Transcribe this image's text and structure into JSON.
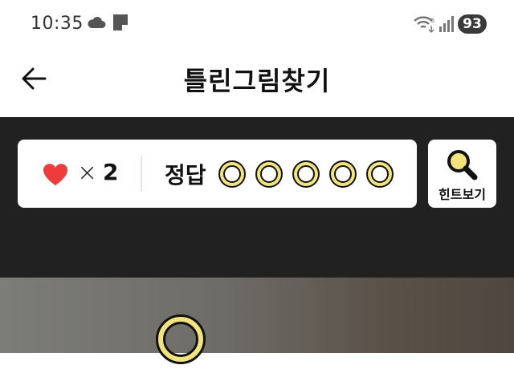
{
  "status_bar": {
    "time": "10:35",
    "icons": [
      "cloud-icon",
      "note-icon",
      "wifi-icon",
      "signal-icon"
    ],
    "battery": "93"
  },
  "app_bar": {
    "back_icon": "arrow-left-icon",
    "title": "틀린그림찾기"
  },
  "game": {
    "lives_icon": "heart-icon",
    "lives_symbol": "×",
    "lives_count": "2",
    "answer_label": "정답",
    "answers_total": 5,
    "answers_found": 0,
    "hint_label": "힌트보기",
    "hint_icon": "magnifier-icon"
  },
  "colors": {
    "accent_yellow": "#f2e37a",
    "heart_red": "#ef3b3b",
    "dark_bg": "#212121"
  }
}
